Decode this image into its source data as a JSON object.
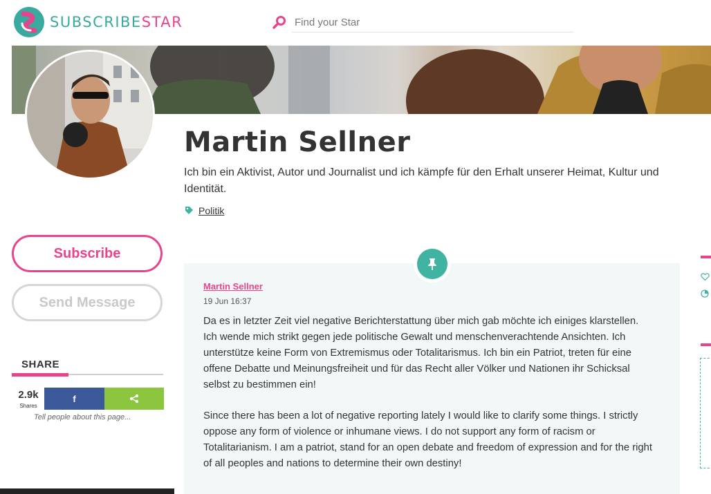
{
  "header": {
    "brand_part1": "SUBSCRIBE",
    "brand_part2": "STAR",
    "search_placeholder": "Find your Star"
  },
  "profile": {
    "name": "Martin Sellner",
    "bio": "Ich bin ein Aktivist, Autor und Journalist und ich kämpfe für den Erhalt unserer Heimat, Kultur und Identität.",
    "category": "Politik"
  },
  "actions": {
    "subscribe_label": "Subscribe",
    "message_label": "Send Message"
  },
  "share": {
    "title": "SHARE",
    "count": "2.9k",
    "count_label": "Shares",
    "facebook_label": "f",
    "hint": "Tell people about this page..."
  },
  "post": {
    "author": "Martin Sellner",
    "date": "19 Jun 16:37",
    "paragraph_de": "Da es in letzter Zeit viel negative Berichterstattung über mich gab möchte ich einiges klarstellen. Ich wende mich strikt gegen jede politische Gewalt und menschenverachtende Ansichten. Ich unterstütze keine Form von Extremismus oder Totalitarismus. Ich bin ein Patriot, treten für eine offene Debatte und Meinungsfreiheit und für das Recht aller Völker und Nationen ihr Schicksal selbst zu bestimmen ein!",
    "paragraph_en": "Since there has been a lot of negative reporting lately I would like to clarify some things. I strictly oppose any form of violence or inhumane views. I do not support any form of racism or Totalitarianism. I am a patriot, stand for an open debate and freedom of expression and for the right of all peoples and nations to determine their own destiny!"
  },
  "colors": {
    "brand_teal": "#3aa9a0",
    "brand_pink": "#e8438d",
    "facebook_blue": "#3b5998",
    "share_green": "#8cc63f",
    "post_bg": "#f1f8f7",
    "pin_teal": "#41b3a3"
  },
  "icons": [
    "logo-icon",
    "search-icon",
    "tag-icon",
    "share-icon",
    "pin-icon",
    "heart-icon",
    "pie-icon"
  ]
}
